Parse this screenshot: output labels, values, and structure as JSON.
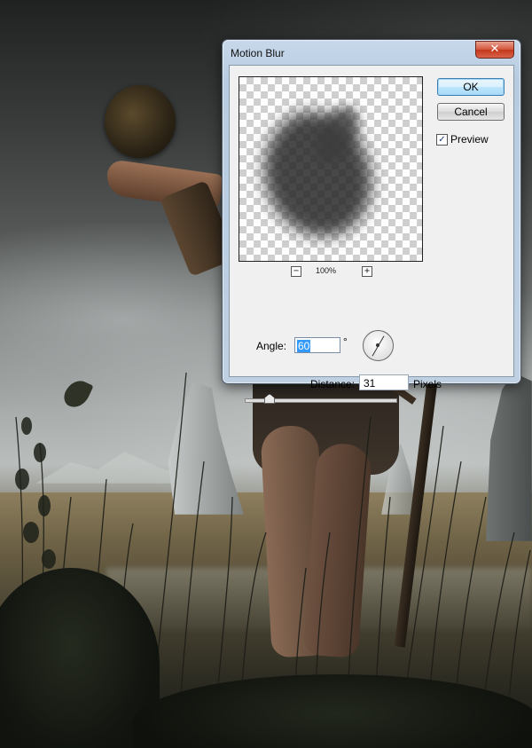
{
  "dialog": {
    "title": "Motion Blur",
    "close_label": "✕",
    "buttons": {
      "ok": "OK",
      "cancel": "Cancel"
    },
    "preview_checkbox": {
      "label": "Preview",
      "checked": true,
      "mark": "✓"
    },
    "zoom": {
      "level": "100%",
      "minus": "−",
      "plus": "+"
    },
    "angle": {
      "label": "Angle:",
      "value": "60",
      "unit": "°"
    },
    "distance": {
      "label": "Distance:",
      "value": "31",
      "unit": "Pixels"
    },
    "icons": {
      "close": "close-icon",
      "angle_dial": "angle-dial-icon",
      "zoom_out": "zoom-out-icon",
      "zoom_in": "zoom-in-icon"
    }
  },
  "colors": {
    "title_bar": "#c7d8ea",
    "close_button": "#c2371b",
    "ok_button_border": "#3c7fb1",
    "selection": "#3399ff"
  }
}
